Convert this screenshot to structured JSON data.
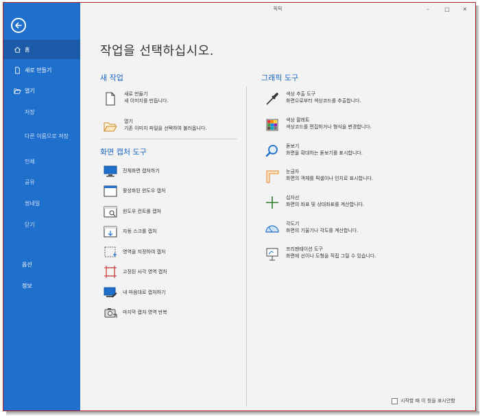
{
  "window": {
    "title": "픽픽",
    "minimize": "–",
    "maximize": "□",
    "close": "✕"
  },
  "sidebar": {
    "items": [
      {
        "label": "홈",
        "icon": "home-icon"
      },
      {
        "label": "새로 만들기",
        "icon": "new-file-icon"
      },
      {
        "label": "열기",
        "icon": "folder-open-icon"
      },
      {
        "label": "저장"
      },
      {
        "label": "다른 이름으로 저장"
      },
      {
        "label": "인쇄"
      },
      {
        "label": "공유"
      },
      {
        "label": "썸네일"
      },
      {
        "label": "닫기"
      },
      {
        "label": "옵션"
      },
      {
        "label": "정보"
      }
    ]
  },
  "main": {
    "heading": "작업을 선택하십시오.",
    "new_task": {
      "title": "새 작업",
      "items": [
        {
          "title": "새로 만들기",
          "desc": "새 이미지를 만듭니다.",
          "icon": "blank-page-icon"
        },
        {
          "title": "열기",
          "desc": "기존 이미지 파일을 선택하여 불러옵니다.",
          "icon": "open-folder-icon"
        }
      ]
    },
    "capture_tools": {
      "title": "화면 캡처 도구",
      "items": [
        {
          "label": "전체화면 캡처하기",
          "icon": "monitor-icon"
        },
        {
          "label": "활성화된 윈도우 캡처",
          "icon": "active-window-icon"
        },
        {
          "label": "윈도우 컨트롤 캡처",
          "icon": "window-control-icon"
        },
        {
          "label": "자동 스크롤 캡처",
          "icon": "scroll-capture-icon"
        },
        {
          "label": "영역을 지정하여 캡처",
          "icon": "region-capture-icon"
        },
        {
          "label": "고정된 사각 영역 캡처",
          "icon": "fixed-rect-icon"
        },
        {
          "label": "내 마음대로 캡처하기",
          "icon": "freehand-capture-icon"
        },
        {
          "label": "마지막 캡처 영역 반복",
          "icon": "repeat-capture-icon"
        }
      ]
    },
    "graphic_tools": {
      "title": "그래픽 도구",
      "items": [
        {
          "title": "색상 추출 도구",
          "desc": "화면으로부터 색상코드를 추출합니다.",
          "icon": "eyedropper-icon"
        },
        {
          "title": "색상 팔레트",
          "desc": "색상코드를 편집하거나 형식을 변경합니다.",
          "icon": "palette-icon"
        },
        {
          "title": "돋보기",
          "desc": "화면을 확대하는 돋보기를 표시합니다.",
          "icon": "magnifier-icon"
        },
        {
          "title": "눈금자",
          "desc": "화면의 객체를 픽셀이나 인치로 표시합니다.",
          "icon": "ruler-icon"
        },
        {
          "title": "십자선",
          "desc": "화면의 좌표 및 상대좌표를 계산합니다.",
          "icon": "crosshair-icon"
        },
        {
          "title": "각도기",
          "desc": "화면의 기울기나 각도를 계산합니다.",
          "icon": "protractor-icon"
        },
        {
          "title": "프리젠테이션 도구",
          "desc": "화면에 선이나 도형을 직접 그릴 수 있습니다.",
          "icon": "whiteboard-icon"
        }
      ]
    }
  },
  "footer": {
    "startup_option": "시작할 때 이 창을 표시안함"
  },
  "colors": {
    "sidebar": "#1f6fcc",
    "accent": "#1a66c4",
    "border": "#b32525"
  }
}
